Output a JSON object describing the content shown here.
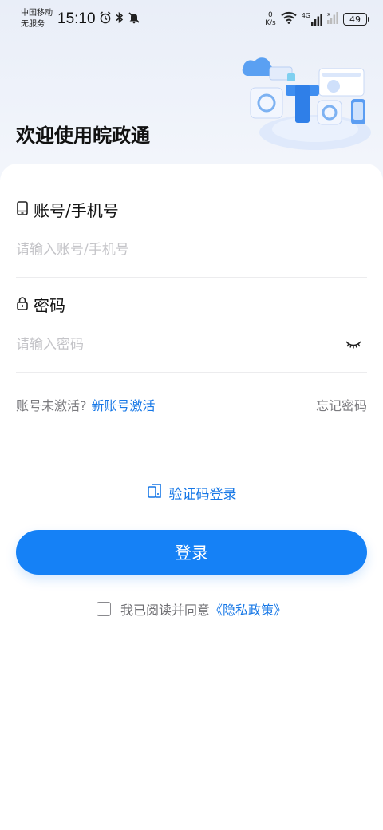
{
  "status_bar": {
    "carrier_line1": "中国移动",
    "carrier_line2": "无服务",
    "time": "15:10",
    "net_speed_value": "0",
    "net_speed_unit": "K/s",
    "network_type": "4G",
    "battery": "49",
    "icons": [
      "alarm-icon",
      "bluetooth-icon",
      "mute-icon",
      "wifi-icon",
      "signal-icon",
      "battery-icon"
    ]
  },
  "header": {
    "welcome_title": "欢迎使用皖政通"
  },
  "form": {
    "account": {
      "label": "账号/手机号",
      "placeholder": "请输入账号/手机号",
      "value": ""
    },
    "password": {
      "label": "密码",
      "placeholder": "请输入密码",
      "value": ""
    }
  },
  "links": {
    "not_activated": "账号未激活?",
    "activate_new": "新账号激活",
    "forgot_password": "忘记密码"
  },
  "sms_login_label": "验证码登录",
  "login_button_label": "登录",
  "agreement": {
    "text": "我已阅读并同意",
    "policy_link": "《隐私政策》",
    "checked": false
  },
  "colors": {
    "primary": "#1581f6",
    "link": "#1677e6",
    "placeholder": "#c4c4c8"
  }
}
